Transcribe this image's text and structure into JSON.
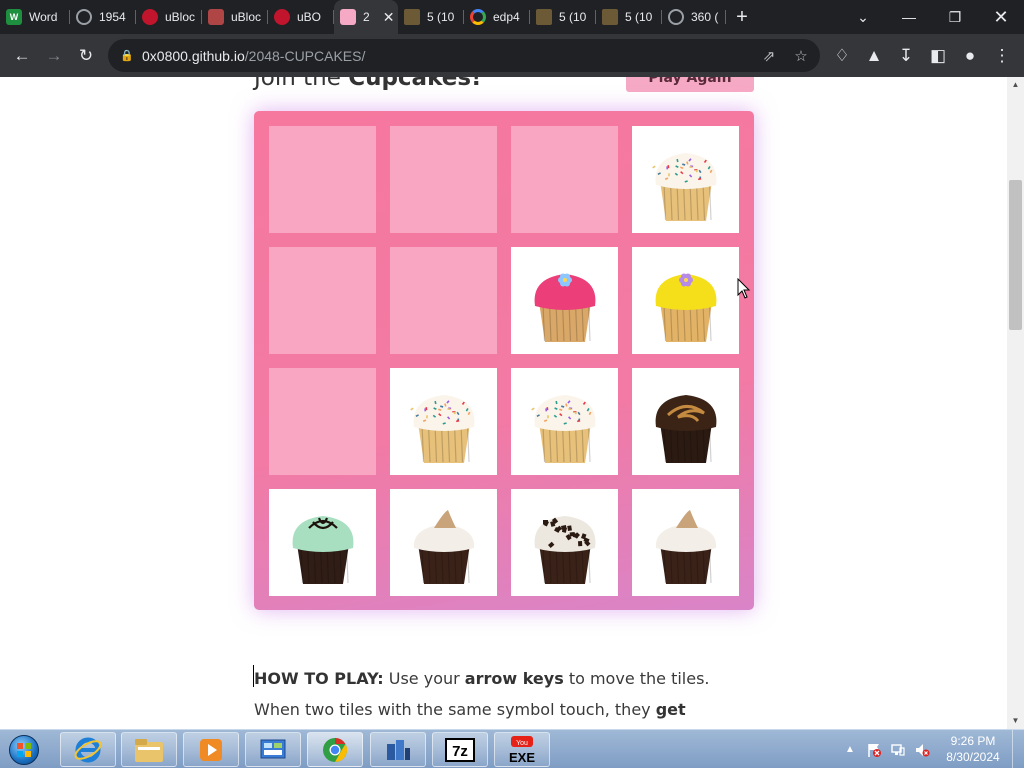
{
  "browser": {
    "tabs": [
      {
        "title": "Word",
        "favicon": "W",
        "fav_color": "#1e8f3e"
      },
      {
        "title": "1954",
        "favicon": "globe-icon",
        "fav_color": "#9aa0a6"
      },
      {
        "title": "uBloc",
        "favicon": "ublock-icon",
        "fav_color": "#c0152d"
      },
      {
        "title": "uBloc",
        "favicon": "image-icon",
        "fav_color": "#b04545"
      },
      {
        "title": "uBO",
        "favicon": "ublock-icon",
        "fav_color": "#c0152d"
      },
      {
        "title": "2",
        "favicon": "cupcake-page-icon",
        "fav_color": "#f6a9c4",
        "active": true
      },
      {
        "title": "5 (10",
        "favicon": "folder-icon",
        "fav_color": "#6b5a35"
      },
      {
        "title": "edp4",
        "favicon": "google-icon",
        "fav_color": "#ffffff"
      },
      {
        "title": "5 (10",
        "favicon": "folder-icon",
        "fav_color": "#6b5a35"
      },
      {
        "title": "5 (10",
        "favicon": "folder-icon",
        "fav_color": "#6b5a35"
      },
      {
        "title": "360 (",
        "favicon": "globe-icon",
        "fav_color": "#9aa0a6"
      }
    ],
    "url_host": "0x0800.github.io",
    "url_path": "/2048-CUPCAKES/"
  },
  "page": {
    "heading_prefix": "Join the ",
    "heading_bold": "Cupcakes!",
    "play_again": "Play Again",
    "howto_label": "HOW TO PLAY:",
    "howto_t1": " Use your ",
    "howto_b1": "arrow keys",
    "howto_t2": " to move the tiles. When two tiles with the same symbol touch, they ",
    "howto_b2": "get promoted!"
  },
  "board": {
    "grid": [
      [
        null,
        null,
        null,
        "vanilla-sprinkles"
      ],
      [
        null,
        null,
        "pink-frosted",
        "yellow-frosted"
      ],
      [
        null,
        "vanilla-sprinkles",
        "vanilla-sprinkles",
        "chocolate-swirl"
      ],
      [
        "mint-chocolate",
        "chocolate-meringue",
        "cookies-and-cream",
        "chocolate-meringue"
      ]
    ]
  },
  "taskbar": {
    "apps": [
      "internet-explorer-icon",
      "file-explorer-icon",
      "media-player-icon",
      "control-panel-icon",
      "chrome-icon",
      "app-icon",
      "7zip-icon",
      "youtube-exe-icon"
    ],
    "time": "9:26 PM",
    "date": "8/30/2024"
  }
}
